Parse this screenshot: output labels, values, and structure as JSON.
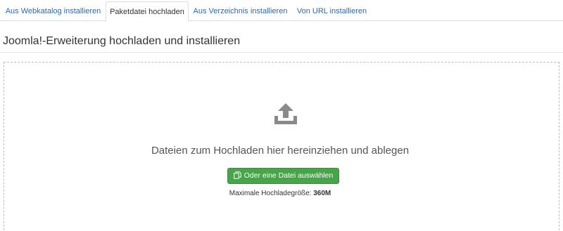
{
  "tabs": [
    {
      "label": "Aus Webkatalog installieren",
      "active": false
    },
    {
      "label": "Paketdatei hochladen",
      "active": true
    },
    {
      "label": "Aus Verzeichnis installieren",
      "active": false
    },
    {
      "label": "Von URL installieren",
      "active": false
    }
  ],
  "page_title": "Joomla!-Erweiterung hochladen und installieren",
  "dropzone": {
    "icon": "upload-icon",
    "drop_text": "Dateien zum Hochladen hier hereinziehen und ablegen",
    "choose_button": {
      "icon": "copy-files-icon",
      "label": "Oder eine Datei auswählen"
    },
    "max_size_label": "Maximale Hochladegröße:",
    "max_size_value": "360M"
  },
  "colors": {
    "link": "#2a69b8",
    "button_green": "#46a546",
    "icon_gray": "#8a8a8a"
  }
}
